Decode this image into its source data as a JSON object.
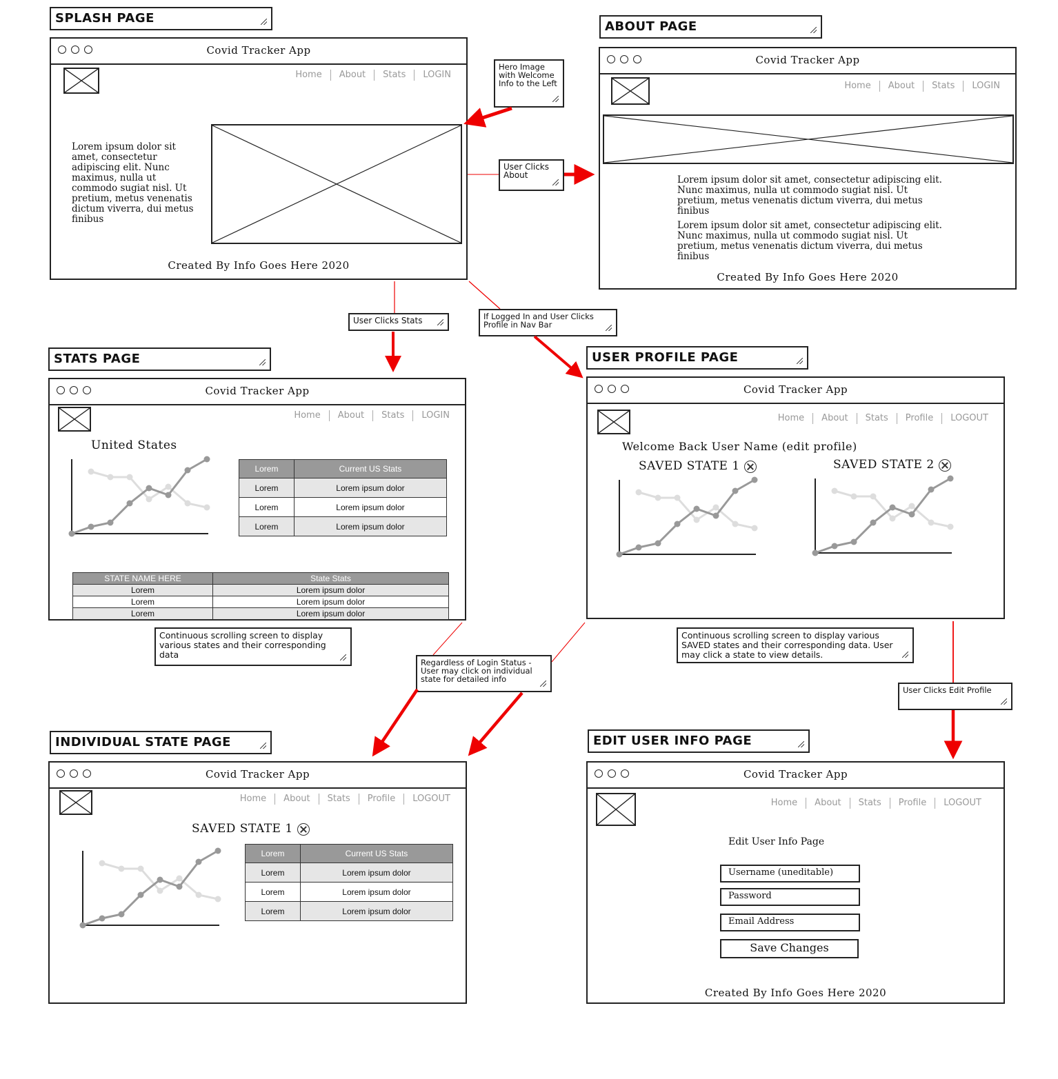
{
  "app_title": "Covid Tracker App",
  "nav_guest": [
    "Home",
    "About",
    "Stats",
    "LOGIN"
  ],
  "nav_user": [
    "Home",
    "About",
    "Stats",
    "Profile",
    "LOGOUT"
  ],
  "footer": "Created By Info Goes Here 2020",
  "titles": {
    "splash": "SPLASH PAGE",
    "about": "ABOUT PAGE",
    "stats": "STATS PAGE",
    "profile": "USER PROFILE PAGE",
    "state": "INDIVIDUAL STATE PAGE",
    "edit": "EDIT USER INFO PAGE"
  },
  "splash": {
    "lorem": "Lorem ipsum dolor sit amet, consectetur adipiscing elit. Nunc maximus, nulla ut commodo sugiat nisl. Ut pretium, metus venenatis dictum viverra, dui metus finibus"
  },
  "about": {
    "para1": "Lorem ipsum dolor sit amet, consectetur adipiscing elit. Nunc maximus, nulla ut commodo sugiat nisl. Ut pretium, metus venenatis dictum viverra, dui metus finibus",
    "para2": "Lorem ipsum dolor sit amet, consectetur adipiscing elit. Nunc maximus, nulla ut commodo sugiat nisl. Ut pretium, metus venenatis dictum viverra, dui metus finibus"
  },
  "stats": {
    "heading": "United States",
    "table_headers": [
      "Lorem",
      "Current US Stats"
    ],
    "table_rows": [
      [
        "Lorem",
        "Lorem ipsum dolor"
      ],
      [
        "Lorem",
        "Lorem ipsum dolor"
      ],
      [
        "Lorem",
        "Lorem ipsum dolor"
      ]
    ],
    "state_headers": [
      "STATE NAME HERE",
      "State Stats"
    ],
    "state_rows": [
      [
        "Lorem",
        "Lorem ipsum dolor"
      ],
      [
        "Lorem",
        "Lorem ipsum dolor"
      ],
      [
        "Lorem",
        "Lorem ipsum dolor"
      ]
    ]
  },
  "profile": {
    "welcome": "Welcome Back User Name (edit profile)",
    "saved1": "SAVED STATE 1",
    "saved2": "SAVED STATE 2"
  },
  "state": {
    "heading": "SAVED STATE 1",
    "table_headers": [
      "Lorem",
      "Current US Stats"
    ],
    "table_rows": [
      [
        "Lorem",
        "Lorem ipsum dolor"
      ],
      [
        "Lorem",
        "Lorem ipsum dolor"
      ],
      [
        "Lorem",
        "Lorem ipsum dolor"
      ]
    ]
  },
  "edit": {
    "heading": "Edit User Info Page",
    "username": "Username (uneditable)",
    "password": "Password",
    "email": "Email Address",
    "save": "Save Changes"
  },
  "notes": {
    "hero": "Hero Image with Welcome Info to the Left",
    "about_click": "User Clicks About",
    "stats_click": "User Clicks Stats",
    "profile_click": "If Logged In and User Clicks Profile in Nav Bar",
    "stats_scroll": "Continuous scrolling screen to display various states and their corresponding data",
    "state_click": "Regardless of Login Status - User may click on individual state for detailed info",
    "profile_scroll": "Continuous scrolling screen to display various SAVED states and their corresponding data.  User may click a state to view details.",
    "edit_click": "User Clicks Edit Profile"
  },
  "colors": {
    "arrow": "#ee0000",
    "line_dark": "#999999",
    "line_light": "#dddddd",
    "table_header": "#999999",
    "table_row": "#e6e6e6"
  }
}
